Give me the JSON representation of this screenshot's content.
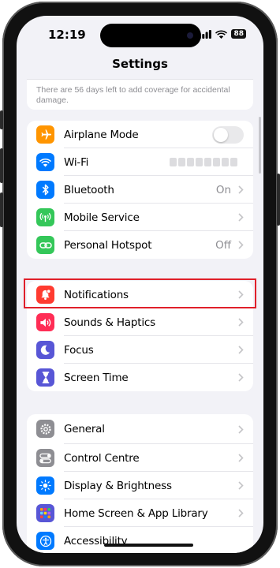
{
  "status_bar": {
    "time": "12:19",
    "battery": "88"
  },
  "nav": {
    "title": "Settings"
  },
  "coverage_note": "There are 56 days left to add coverage for accidental damage.",
  "group1": [
    {
      "label": "Airplane Mode",
      "value": "",
      "icon": "airplane-icon",
      "color": "#ff9500",
      "control": "toggle",
      "toggle_on": false
    },
    {
      "label": "Wi-Fi",
      "value": "",
      "icon": "wifi-icon",
      "color": "#007aff",
      "control": "blurred"
    },
    {
      "label": "Bluetooth",
      "value": "On",
      "icon": "bluetooth-icon",
      "color": "#007aff",
      "control": "chevron"
    },
    {
      "label": "Mobile Service",
      "value": "",
      "icon": "antenna-icon",
      "color": "#34c759",
      "control": "chevron"
    },
    {
      "label": "Personal Hotspot",
      "value": "Off",
      "icon": "hotspot-icon",
      "color": "#34c759",
      "control": "chevron"
    }
  ],
  "group2": [
    {
      "label": "Notifications",
      "icon": "bell-icon",
      "color": "#ff3b30",
      "highlighted": true
    },
    {
      "label": "Sounds & Haptics",
      "icon": "speaker-icon",
      "color": "#ff2d55"
    },
    {
      "label": "Focus",
      "icon": "moon-icon",
      "color": "#5856d6"
    },
    {
      "label": "Screen Time",
      "icon": "hourglass-icon",
      "color": "#5856d6"
    }
  ],
  "group3": [
    {
      "label": "General",
      "icon": "gear-icon",
      "color": "#8e8e93"
    },
    {
      "label": "Control Centre",
      "icon": "switches-icon",
      "color": "#8e8e93"
    },
    {
      "label": "Display & Brightness",
      "icon": "sun-icon",
      "color": "#007aff"
    },
    {
      "label": "Home Screen & App Library",
      "icon": "grid-icon",
      "color": "#5856d6"
    },
    {
      "label": "Accessibility",
      "icon": "accessibility-icon",
      "color": "#007aff"
    }
  ],
  "highlight_color": "#e0202a"
}
